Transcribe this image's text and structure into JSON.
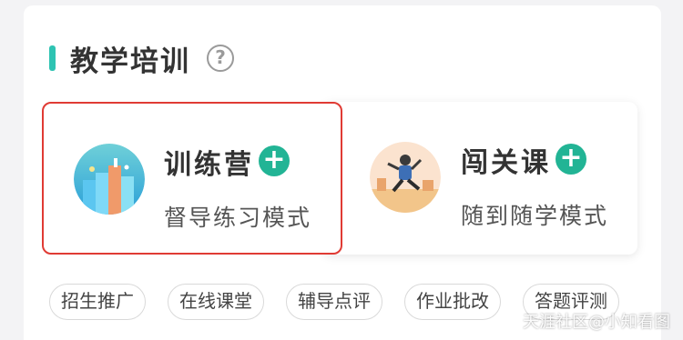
{
  "section": {
    "title": "教学培训",
    "help_icon": "question-circle-icon",
    "accent_color": "#2ec3b2"
  },
  "tiles": [
    {
      "name": "训练营",
      "subtitle": "督导练习模式",
      "icon": "bar-chart-illustration",
      "selected": true
    },
    {
      "name": "闯关课",
      "subtitle": "随到随学模式",
      "icon": "runner-illustration",
      "selected": false
    }
  ],
  "plus_color": "#22b495",
  "selection_color": "#e03b34",
  "tags": [
    "招生推广",
    "在线课堂",
    "辅导点评",
    "作业批改",
    "答题评测"
  ],
  "watermark": "天涯社区@小知看图"
}
